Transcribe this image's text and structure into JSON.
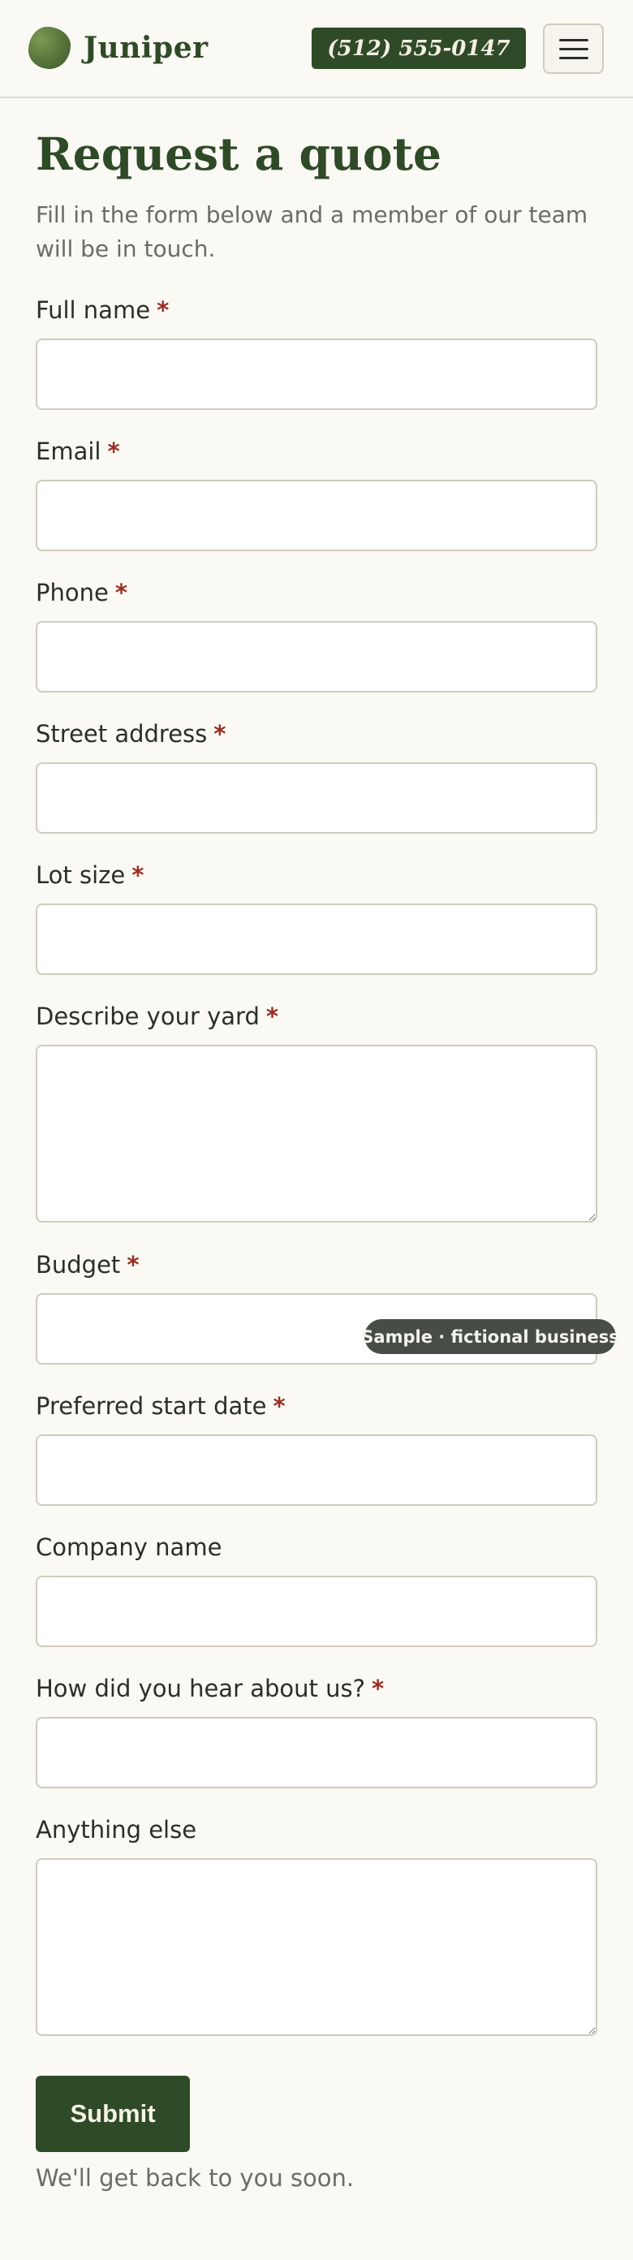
{
  "brand": {
    "name": "Juniper",
    "logo_icon": "leaf-icon",
    "primary_color": "#2f4a27",
    "required_color": "#9b2c22"
  },
  "header": {
    "phone_label": "(512) 555-0147",
    "menu_icon": "hamburger-menu-icon"
  },
  "form": {
    "title": "Request a quote",
    "intro": "Fill in the form below and a member of our team will be in touch.",
    "required_marker": "*",
    "fields": [
      {
        "label": "Full name",
        "required": true,
        "type": "text",
        "value": ""
      },
      {
        "label": "Email",
        "required": true,
        "type": "text",
        "value": ""
      },
      {
        "label": "Phone",
        "required": true,
        "type": "text",
        "value": ""
      },
      {
        "label": "Street address",
        "required": true,
        "type": "text",
        "value": ""
      },
      {
        "label": "Lot size",
        "required": true,
        "type": "text",
        "value": ""
      },
      {
        "label": "Describe your yard",
        "required": true,
        "type": "textarea",
        "value": ""
      },
      {
        "label": "Budget",
        "required": true,
        "type": "text",
        "value": ""
      },
      {
        "label": "Preferred start date",
        "required": true,
        "type": "text",
        "value": ""
      },
      {
        "label": "Company name",
        "required": false,
        "type": "text",
        "value": ""
      },
      {
        "label": "How did you hear about us?",
        "required": true,
        "type": "text",
        "value": ""
      },
      {
        "label": "Anything else",
        "required": false,
        "type": "textarea",
        "value": ""
      }
    ],
    "submit_label": "Submit",
    "footnote": "We'll get back to you soon."
  },
  "badge": {
    "text": "Sample · fictional business"
  }
}
